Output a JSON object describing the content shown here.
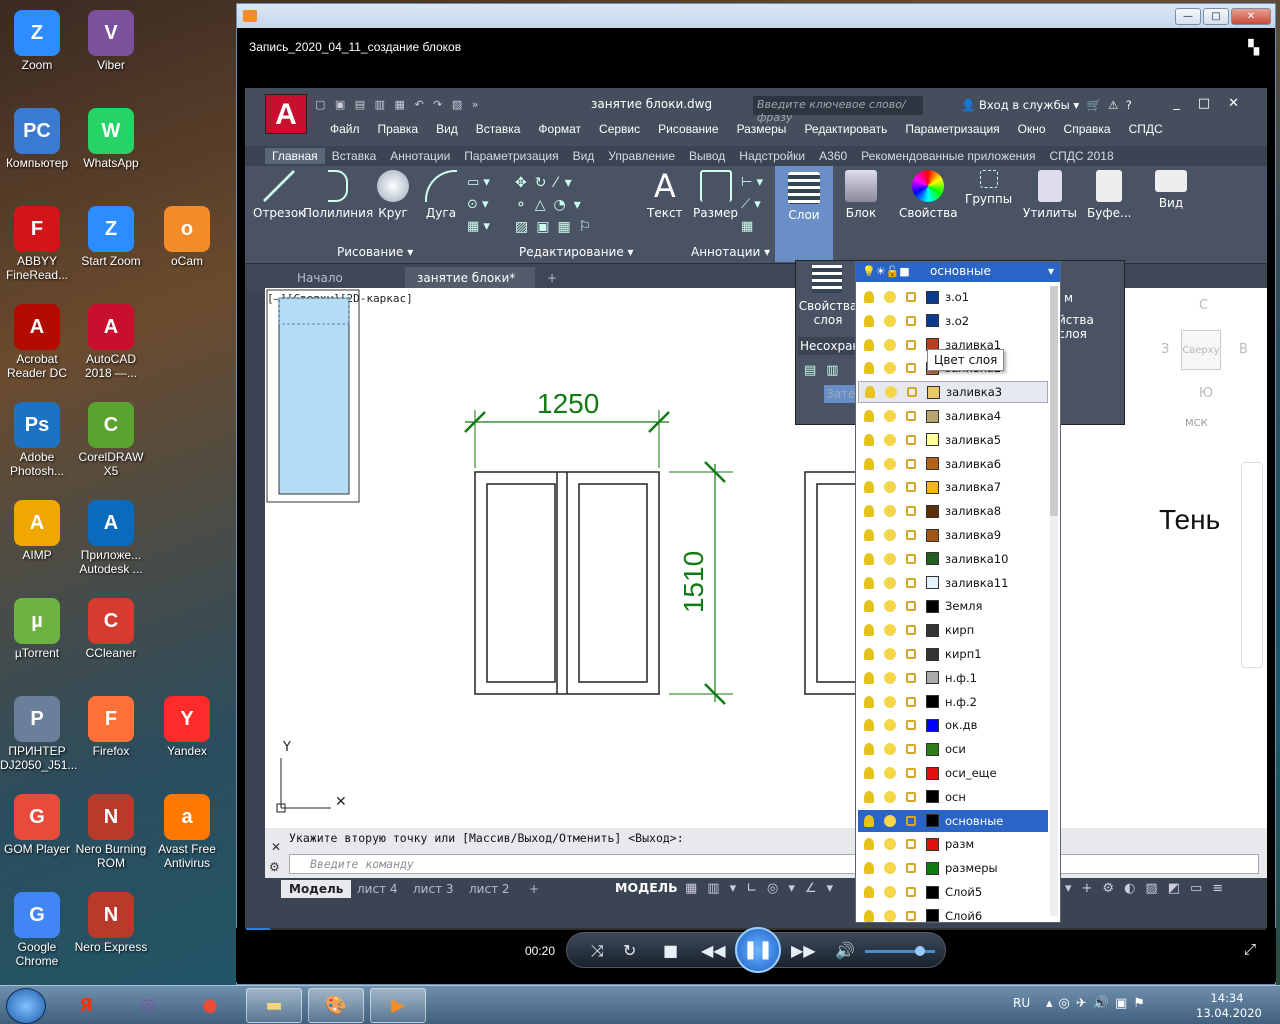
{
  "desktop": {
    "icons": [
      {
        "label": "Zoom",
        "color": "#2d8cff",
        "glyph": "Z"
      },
      {
        "label": "Viber",
        "color": "#7b519d",
        "glyph": "V"
      },
      {
        "label": "Компьютер",
        "color": "#3a7ad1",
        "glyph": "PC"
      },
      {
        "label": "WhatsApp",
        "color": "#25d366",
        "glyph": "W"
      },
      {
        "label": "ABBYY FineRead...",
        "color": "#d4131b",
        "glyph": "F"
      },
      {
        "label": "Start Zoom",
        "color": "#2d8cff",
        "glyph": "Z"
      },
      {
        "label": "oCam",
        "color": "#f28c28",
        "glyph": "o"
      },
      {
        "label": "Acrobat Reader DC",
        "color": "#b30b00",
        "glyph": "A"
      },
      {
        "label": "AutoCAD 2018 —...",
        "color": "#c8102e",
        "glyph": "A"
      },
      {
        "label": "Adobe Photosh...",
        "color": "#1c73c2",
        "glyph": "Ps"
      },
      {
        "label": "CorelDRAW X5",
        "color": "#5aa331",
        "glyph": "C"
      },
      {
        "label": "AIMP",
        "color": "#f0a800",
        "glyph": "A"
      },
      {
        "label": "Приложе... Autodesk ...",
        "color": "#0a6bbd",
        "glyph": "A"
      },
      {
        "label": "µTorrent",
        "color": "#6db33f",
        "glyph": "µ"
      },
      {
        "label": "CCleaner",
        "color": "#d63b2f",
        "glyph": "C"
      },
      {
        "label": "ПРИНТЕР DJ2050_J51...",
        "color": "#6a7f99",
        "glyph": "P"
      },
      {
        "label": "Firefox",
        "color": "#ff7139",
        "glyph": "F"
      },
      {
        "label": "Yandex",
        "color": "#ff2a2a",
        "glyph": "Y"
      },
      {
        "label": "GOM Player",
        "color": "#e84b3a",
        "glyph": "G"
      },
      {
        "label": "Nero Burning ROM",
        "color": "#b83a2b",
        "glyph": "N"
      },
      {
        "label": "Avast Free Antivirus",
        "color": "#ff7800",
        "glyph": "a"
      },
      {
        "label": "Google Chrome",
        "color": "#4285f4",
        "glyph": "G"
      },
      {
        "label": "Nero Express",
        "color": "#b83a2b",
        "glyph": "N"
      }
    ]
  },
  "player": {
    "title": "Запись_2020_04_11_создание блоков",
    "time": "00:20",
    "volume_level": 0.7,
    "progress": 0.02
  },
  "acad": {
    "doc_title": "занятие блоки.dwg",
    "search_placeholder": "Введите ключевое слово/фразу",
    "signin": "Вход в службы",
    "menu": [
      "Файл",
      "Правка",
      "Вид",
      "Вставка",
      "Формат",
      "Сервис",
      "Рисование",
      "Размеры",
      "Редактировать",
      "Параметризация",
      "Окно",
      "Справка",
      "СПДС"
    ],
    "ribbon_tabs": [
      "Главная",
      "Вставка",
      "Аннотации",
      "Параметризация",
      "Вид",
      "Управление",
      "Вывод",
      "Надстройки",
      "A360",
      "Рекомендованные приложения",
      "СПДС 2018"
    ],
    "tools": {
      "line": "Отрезок",
      "polyline": "Полилиния",
      "circle": "Круг",
      "arc": "Дуга",
      "text": "Текст",
      "dimension": "Размер",
      "layers": "Слои",
      "block": "Блок",
      "properties": "Свойства",
      "groups": "Группы",
      "utilities": "Утилиты",
      "clipboard": "Буфе...",
      "view": "Вид"
    },
    "panels": {
      "draw": "Рисование",
      "modify": "Редактирование",
      "annotation": "Аннотации"
    },
    "file_tabs": {
      "start": "Начало",
      "doc": "занятие блоки*"
    },
    "viewport_label": "[–][Сверху][2D-каркас]",
    "drawing": {
      "dim_horizontal": "1250",
      "dim_vertical": "1510",
      "shadow_text": "Тень"
    },
    "viewcube": {
      "north": "С",
      "south": "Ю",
      "west": "З",
      "east": "В",
      "face": "Сверху",
      "ucs": "МСК"
    },
    "command": {
      "previous": "Укажите вторую точку или [Массив/Выход/Отменить] <Выход>:",
      "placeholder": "Введите команду"
    },
    "layout_tabs": [
      "Модель",
      "лист 4",
      "лист 3",
      "лист 2"
    ],
    "model_button": "МОДЕЛЬ",
    "flyout": {
      "layer_props": "Свойства слоя",
      "unsaved": "Несохран",
      "shade": "Затен",
      "right_label_1": "м",
      "right_label_2": "йства слоя"
    },
    "layer_dropdown": {
      "current": "основные",
      "tooltip": "Цвет слоя",
      "layers": [
        {
          "name": "з.о1",
          "color": "#0b3c8c"
        },
        {
          "name": "з.о2",
          "color": "#0b3c8c"
        },
        {
          "name": "заливка1",
          "color": "#b5401f"
        },
        {
          "name": "заливка2",
          "color": "#c97a20"
        },
        {
          "name": "заливка3",
          "color": "#e7c86a"
        },
        {
          "name": "заливка4",
          "color": "#b8a672"
        },
        {
          "name": "заливка5",
          "color": "#ffff99"
        },
        {
          "name": "заливка6",
          "color": "#b2631a"
        },
        {
          "name": "заливка7",
          "color": "#f5b41b"
        },
        {
          "name": "заливка8",
          "color": "#5a3008"
        },
        {
          "name": "заливка9",
          "color": "#a35515"
        },
        {
          "name": "заливка10",
          "color": "#1f5f1f"
        },
        {
          "name": "заливка11",
          "color": "#e5f3ff"
        },
        {
          "name": "Земля",
          "color": "#000000"
        },
        {
          "name": "кирп",
          "color": "#333333"
        },
        {
          "name": "кирп1",
          "color": "#333333"
        },
        {
          "name": "н.ф.1",
          "color": "#aaaaaa"
        },
        {
          "name": "н.ф.2",
          "color": "#000000"
        },
        {
          "name": "ок.дв",
          "color": "#0000ff"
        },
        {
          "name": "оси",
          "color": "#2e7d1a"
        },
        {
          "name": "оси_еще",
          "color": "#e01010"
        },
        {
          "name": "осн",
          "color": "#000000"
        },
        {
          "name": "основные",
          "color": "#000000"
        },
        {
          "name": "разм",
          "color": "#e01010"
        },
        {
          "name": "размеры",
          "color": "#127a12"
        },
        {
          "name": "Слой5",
          "color": "#000000"
        },
        {
          "name": "Слой6",
          "color": "#000000"
        }
      ]
    }
  },
  "taskbar": {
    "lang": "RU",
    "time": "14:34",
    "date": "13.04.2020"
  }
}
